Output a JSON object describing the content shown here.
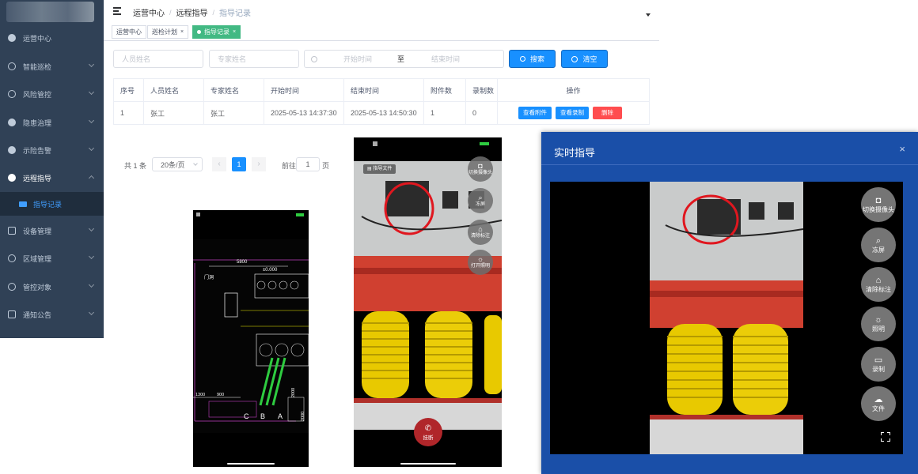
{
  "sidebar": {
    "items": [
      {
        "label": "运营中心",
        "icon": "dashboard-icon"
      },
      {
        "label": "智能巡检",
        "icon": "patrol-icon"
      },
      {
        "label": "风险管控",
        "icon": "risk-icon"
      },
      {
        "label": "隐患治理",
        "icon": "hazard-icon"
      },
      {
        "label": "示险告警",
        "icon": "location-alarm-icon"
      },
      {
        "label": "远程指导",
        "icon": "user-icon"
      },
      {
        "label": "指导记录",
        "icon": "record-icon"
      },
      {
        "label": "设备管理",
        "icon": "device-icon"
      },
      {
        "label": "区域管理",
        "icon": "area-icon"
      },
      {
        "label": "管控对象",
        "icon": "target-icon"
      },
      {
        "label": "通知公告",
        "icon": "notice-icon"
      }
    ]
  },
  "header": {
    "breadcrumb": [
      "运营中心",
      "远程指导",
      "指导记录"
    ],
    "separator": "/",
    "tabs": [
      "运营中心",
      "巡检计划",
      "指导记录"
    ]
  },
  "search": {
    "person_placeholder": "人员姓名",
    "expert_placeholder": "专家姓名",
    "start_placeholder": "开始时间",
    "range_sep": "至",
    "end_placeholder": "结束时间",
    "search_label": "搜索",
    "clear_label": "清空"
  },
  "table": {
    "headers": [
      "序号",
      "人员姓名",
      "专家姓名",
      "开始时间",
      "结束时间",
      "附件数",
      "录制数",
      "操作"
    ],
    "rows": [
      {
        "no": "1",
        "person": "张工",
        "expert": "张工",
        "start": "2025-05-13 14:37:30",
        "end": "2025-05-13 14:50:30",
        "attachments": "1",
        "recordings": "0"
      }
    ],
    "actions": {
      "view_attachments": "查看附件",
      "view_recordings": "查看录制",
      "delete": "删除"
    }
  },
  "pagination": {
    "total": "共 1 条",
    "page_size": "20条/页",
    "current_page": "1",
    "goto_label": "前往",
    "goto_value": "1",
    "page_suffix": "页"
  },
  "drawing_phone": {
    "dims": [
      "5800",
      "±0.000",
      "1300",
      "900",
      "2000",
      "2000"
    ],
    "note": "门洞",
    "phases": [
      "C",
      "B",
      "A"
    ]
  },
  "camera_phone": {
    "file_label": "指导文件",
    "buttons": [
      "切换摄像头",
      "冻屏",
      "清除标注",
      "打开照明"
    ],
    "hangup_label": "挂断"
  },
  "dialog": {
    "title": "实时指导",
    "buttons": [
      {
        "label": "切换摄像头",
        "icon": "camera-icon"
      },
      {
        "label": "冻屏",
        "icon": "freeze-icon"
      },
      {
        "label": "清除标注",
        "icon": "eraser-icon"
      },
      {
        "label": "照明",
        "icon": "light-icon"
      },
      {
        "label": "录制",
        "icon": "record-video-icon"
      },
      {
        "label": "文件",
        "icon": "cloud-file-icon"
      }
    ]
  },
  "colors": {
    "sidebar_bg": "#304156",
    "primary": "#1890ff",
    "active_tag": "#42b983",
    "danger": "#ff4d4f",
    "dialog_bg": "#1a4fa8"
  }
}
